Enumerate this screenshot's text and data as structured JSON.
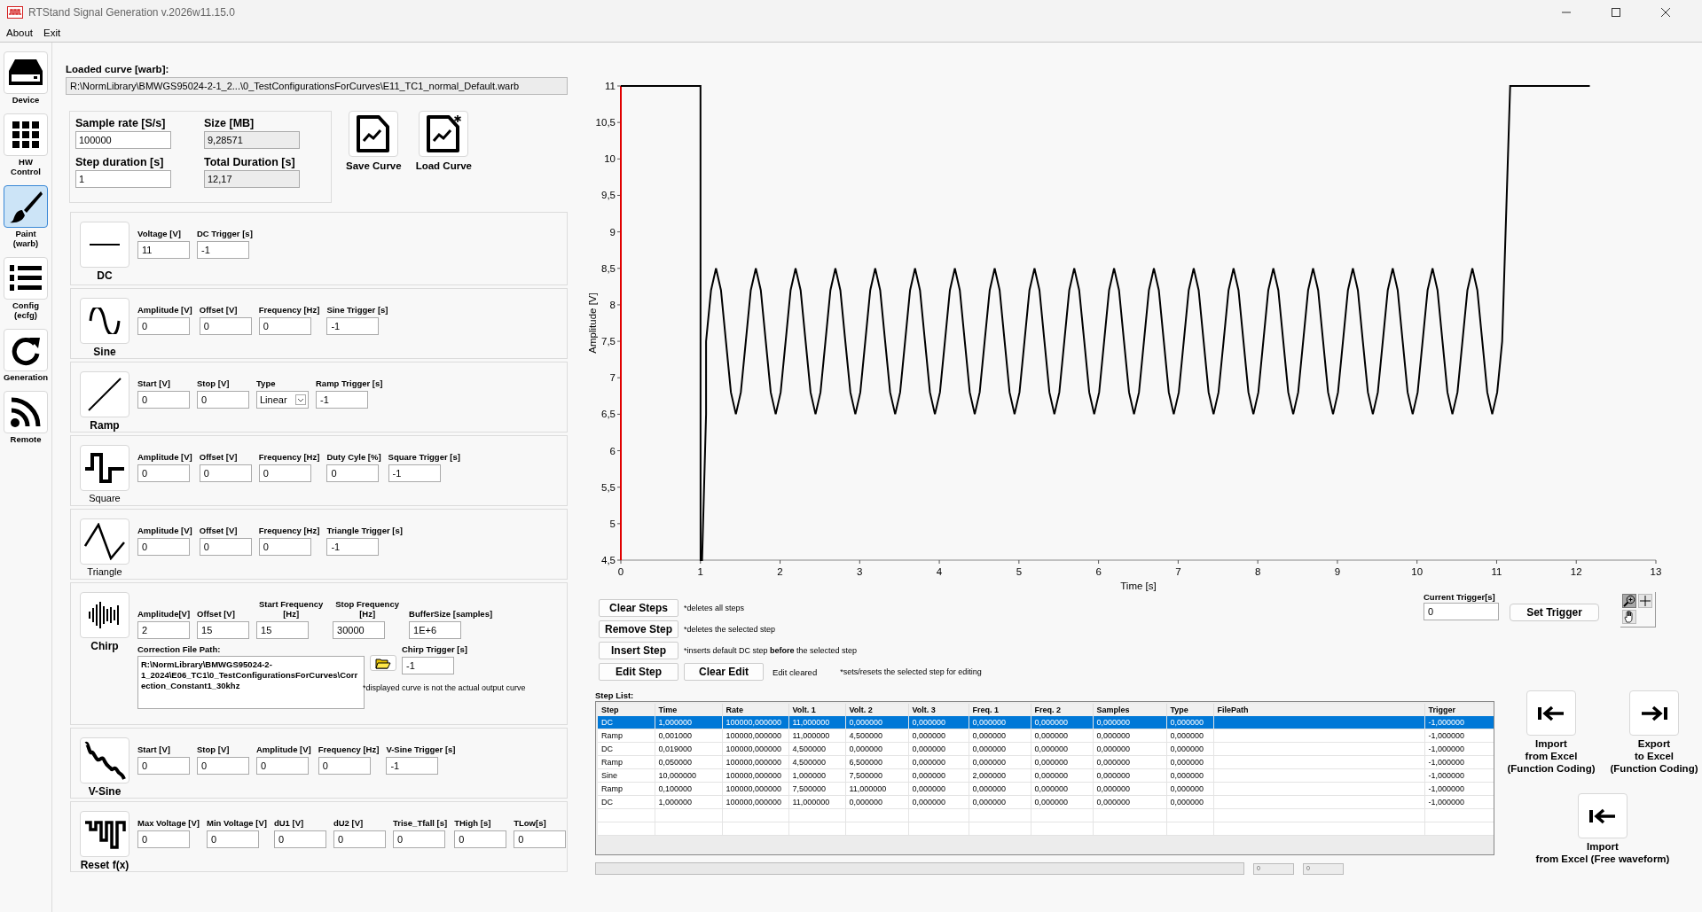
{
  "window": {
    "title": "RTStand Signal Generation v.2026w11.15.0"
  },
  "menu": [
    "About",
    "Exit"
  ],
  "sidebar": {
    "items": [
      {
        "label": "Device",
        "kind": "device",
        "selected": false
      },
      {
        "label": "HW Control",
        "kind": "grid",
        "selected": false
      },
      {
        "label": "Paint (warb)",
        "kind": "brush",
        "selected": true
      },
      {
        "label": "Config (ecfg)",
        "kind": "list",
        "selected": false
      },
      {
        "label": "Generation",
        "kind": "refresh",
        "selected": false
      },
      {
        "label": "Remote",
        "kind": "feed",
        "selected": false
      }
    ]
  },
  "loaded_curve": {
    "label": "Loaded curve [warb]:",
    "value": "R:\\NormLibrary\\BMWGS95024-2-1_2...\\0_TestConfigurationsForCurves\\E11_TC1_normal_Default.warb"
  },
  "parameters": [
    {
      "label": "Sample rate [S/s]",
      "value": "100000",
      "readonly": false
    },
    {
      "label": "Size [MB]",
      "value": "9,28571",
      "readonly": true
    },
    {
      "label": "Step duration [s]",
      "value": "1",
      "readonly": false
    },
    {
      "label": "Total Duration [s]",
      "value": "12,17",
      "readonly": true
    }
  ],
  "curve_buttons": [
    {
      "label": "Save Curve",
      "kind": "save"
    },
    {
      "label": "Load Curve",
      "kind": "load"
    }
  ],
  "functions": [
    {
      "name": "DC",
      "kind": "dc",
      "bold": true,
      "fields": [
        {
          "label": "Voltage [V]",
          "value": "11"
        },
        {
          "label": "DC Trigger [s]",
          "value": "-1"
        }
      ]
    },
    {
      "name": "Sine",
      "kind": "sine",
      "bold": true,
      "fields": [
        {
          "label": "Amplitude [V]",
          "value": "0"
        },
        {
          "label": "Offset [V]",
          "value": "0"
        },
        {
          "label": "Frequency [Hz]",
          "value": "0"
        },
        {
          "label": "Sine Trigger [s]",
          "value": "-1"
        }
      ]
    },
    {
      "name": "Ramp",
      "kind": "ramp",
      "bold": true,
      "fields": [
        {
          "label": "Start [V]",
          "value": "0"
        },
        {
          "label": "Stop [V]",
          "value": "0"
        },
        {
          "label": "Type",
          "value": "Linear",
          "kind": "select"
        },
        {
          "label": "Ramp Trigger [s]",
          "value": "-1"
        }
      ]
    },
    {
      "name": "Square",
      "kind": "square",
      "bold": false,
      "fields": [
        {
          "label": "Amplitude [V]",
          "value": "0"
        },
        {
          "label": "Offset [V]",
          "value": "0"
        },
        {
          "label": "Frequency [Hz]",
          "value": "0"
        },
        {
          "label": "Duty Cyle [%]",
          "value": "0"
        },
        {
          "label": "Square Trigger [s]",
          "value": "-1"
        }
      ]
    },
    {
      "name": "Triangle",
      "kind": "triangle",
      "bold": false,
      "fields": [
        {
          "label": "Amplitude [V]",
          "value": "0"
        },
        {
          "label": "Offset [V]",
          "value": "0"
        },
        {
          "label": "Frequency [Hz]",
          "value": "0"
        },
        {
          "label": "Triangle Trigger [s]",
          "value": "-1"
        }
      ]
    },
    {
      "name": "Chirp",
      "kind": "chirp",
      "bold": true,
      "fields": [
        {
          "label": "Amplitude[V]",
          "value": "2"
        },
        {
          "label": "Offset [V]",
          "value": "15"
        },
        {
          "label": "Start Frequency [Hz]",
          "value": "15"
        },
        {
          "label": "Stop Frequency [Hz]",
          "value": "30000"
        },
        {
          "label": "BufferSize [samples]",
          "value": "1E+6"
        }
      ],
      "file": {
        "label": "Correction File Path:",
        "value": "R:\\NormLibrary\\BMWGS95024-2-1_2024\\E06_TC1\\0_TestConfigurationsForCurves\\Correction_Constant1_30khz"
      },
      "trigger": {
        "label": "Chirp Trigger [s]",
        "value": "-1"
      },
      "note": "*displayed curve is not the actual output curve"
    },
    {
      "name": "V-Sine",
      "kind": "vsine",
      "bold": true,
      "fields": [
        {
          "label": "Start [V]",
          "value": "0"
        },
        {
          "label": "Stop [V]",
          "value": "0"
        },
        {
          "label": "Amplitude [V]",
          "value": "0"
        },
        {
          "label": "Frequency [Hz]",
          "value": "0"
        },
        {
          "label": "V-Sine Trigger [s]",
          "value": "-1"
        }
      ]
    },
    {
      "name": "Reset f(x)",
      "kind": "reset",
      "bold": true,
      "fields": [
        {
          "label": "Max Voltage [V]",
          "value": "0"
        },
        {
          "label": "Min Voltage [V]",
          "value": "0"
        },
        {
          "label": "dU1 [V]",
          "value": "0"
        },
        {
          "label": "dU2 [V]",
          "value": "0"
        },
        {
          "label": "Trise_Tfall [s]",
          "value": "0"
        },
        {
          "label": "THigh [s]",
          "value": "0"
        },
        {
          "label": "TLow[s]",
          "value": "0"
        }
      ]
    }
  ],
  "chart": {
    "chart_data": {
      "type": "line",
      "xlabel": "Time [s]",
      "ylabel": "Amplitude [V]",
      "xlim": [
        0,
        13
      ],
      "ylim": [
        4.5,
        11
      ],
      "xticks": [
        0,
        1,
        2,
        3,
        4,
        5,
        6,
        7,
        8,
        9,
        10,
        11,
        12,
        13
      ],
      "yticks": [
        {
          "value": 4.5,
          "label": "4,5"
        },
        5,
        {
          "value": 5.5,
          "label": "5,5"
        },
        6,
        {
          "value": 6.5,
          "label": "6,5"
        },
        7,
        {
          "value": 7.5,
          "label": "7,5"
        },
        8,
        {
          "value": 8.5,
          "label": "8,5"
        },
        9,
        {
          "value": 9.5,
          "label": "9,5"
        },
        10,
        {
          "value": 10.5,
          "label": "10,5"
        },
        11
      ],
      "x": [
        0,
        1,
        1.001,
        1.02,
        1.07,
        1.07,
        1.1325,
        1.195,
        1.2575,
        1.32,
        1.3825,
        1.445,
        1.5075,
        1.57,
        1.6325,
        1.695,
        1.7575,
        1.82,
        1.8825,
        1.945,
        2.0075,
        2.07,
        2.1325,
        2.195,
        2.2575,
        2.32,
        2.3825,
        2.445,
        2.5075,
        2.57,
        2.6325,
        2.695,
        2.7575,
        2.82,
        2.8825,
        2.945,
        3.0075,
        3.07,
        3.1325,
        3.195,
        3.2575,
        3.32,
        3.3825,
        3.445,
        3.5075,
        3.57,
        3.6325,
        3.695,
        3.7575,
        3.82,
        3.8825,
        3.945,
        4.0075,
        4.07,
        4.1325,
        4.195,
        4.2575,
        4.32,
        4.3825,
        4.445,
        4.5075,
        4.57,
        4.6325,
        4.695,
        4.7575,
        4.82,
        4.8825,
        4.945,
        5.0075,
        5.07,
        5.1325,
        5.195,
        5.2575,
        5.32,
        5.3825,
        5.445,
        5.5075,
        5.57,
        5.6325,
        5.695,
        5.7575,
        5.82,
        5.8825,
        5.945,
        6.0075,
        6.07,
        6.1325,
        6.195,
        6.2575,
        6.32,
        6.3825,
        6.445,
        6.5075,
        6.57,
        6.6325,
        6.695,
        6.7575,
        6.82,
        6.8825,
        6.945,
        7.0075,
        7.07,
        7.1325,
        7.195,
        7.2575,
        7.32,
        7.3825,
        7.445,
        7.5075,
        7.57,
        7.6325,
        7.695,
        7.7575,
        7.82,
        7.8825,
        7.945,
        8.0075,
        8.07,
        8.1325,
        8.195,
        8.2575,
        8.32,
        8.3825,
        8.445,
        8.5075,
        8.57,
        8.6325,
        8.695,
        8.7575,
        8.82,
        8.8825,
        8.945,
        9.0075,
        9.07,
        9.1325,
        9.195,
        9.2575,
        9.32,
        9.3825,
        9.445,
        9.5075,
        9.57,
        9.6325,
        9.695,
        9.7575,
        9.82,
        9.8825,
        9.945,
        10.0075,
        10.07,
        10.1325,
        10.195,
        10.2575,
        10.32,
        10.3825,
        10.445,
        10.5075,
        10.57,
        10.6325,
        10.695,
        10.7575,
        10.82,
        10.8825,
        10.945,
        11.0075,
        11.07,
        11.17,
        12.17
      ],
      "series": [
        {
          "color": "#000000",
          "values": [
            11,
            11,
            4.5,
            4.5,
            6.5,
            7.5,
            8.2,
            8.5,
            8.2,
            7.5,
            6.8,
            6.5,
            6.8,
            7.5,
            8.2,
            8.5,
            8.2,
            7.5,
            6.8,
            6.5,
            6.8,
            7.5,
            8.2,
            8.5,
            8.2,
            7.5,
            6.8,
            6.5,
            6.8,
            7.5,
            8.2,
            8.5,
            8.2,
            7.5,
            6.8,
            6.5,
            6.8,
            7.5,
            8.2,
            8.5,
            8.2,
            7.5,
            6.8,
            6.5,
            6.8,
            7.5,
            8.2,
            8.5,
            8.2,
            7.5,
            6.8,
            6.5,
            6.8,
            7.5,
            8.2,
            8.5,
            8.2,
            7.5,
            6.8,
            6.5,
            6.8,
            7.5,
            8.2,
            8.5,
            8.2,
            7.5,
            6.8,
            6.5,
            6.8,
            7.5,
            8.2,
            8.5,
            8.2,
            7.5,
            6.8,
            6.5,
            6.8,
            7.5,
            8.2,
            8.5,
            8.2,
            7.5,
            6.8,
            6.5,
            6.8,
            7.5,
            8.2,
            8.5,
            8.2,
            7.5,
            6.8,
            6.5,
            6.8,
            7.5,
            8.2,
            8.5,
            8.2,
            7.5,
            6.8,
            6.5,
            6.8,
            7.5,
            8.2,
            8.5,
            8.2,
            7.5,
            6.8,
            6.5,
            6.8,
            7.5,
            8.2,
            8.5,
            8.2,
            7.5,
            6.8,
            6.5,
            6.8,
            7.5,
            8.2,
            8.5,
            8.2,
            7.5,
            6.8,
            6.5,
            6.8,
            7.5,
            8.2,
            8.5,
            8.2,
            7.5,
            6.8,
            6.5,
            6.8,
            7.5,
            8.2,
            8.5,
            8.2,
            7.5,
            6.8,
            6.5,
            6.8,
            7.5,
            8.2,
            8.5,
            8.2,
            7.5,
            6.8,
            6.5,
            6.8,
            7.5,
            8.2,
            8.5,
            8.2,
            7.5,
            6.8,
            6.5,
            6.8,
            7.5,
            8.2,
            8.5,
            8.2,
            7.5,
            6.8,
            6.5,
            6.8,
            7.5,
            11,
            11
          ]
        }
      ]
    }
  },
  "step_actions": [
    {
      "buttons": [
        "Clear Steps"
      ],
      "note": "*deletes all steps"
    },
    {
      "buttons": [
        "Remove Step"
      ],
      "note": "*deletes the selected step"
    },
    {
      "buttons": [
        "Insert Step"
      ],
      "note": "*inserts default DC step **before** the selected step"
    },
    {
      "buttons": [
        "Edit Step",
        "Clear Edit"
      ],
      "status": "Edit cleared",
      "note": "*sets/resets the selected step for editing"
    }
  ],
  "trigger": {
    "label": "Current Trigger[s]",
    "value": "0",
    "button": "Set Trigger"
  },
  "graph_tools": [
    {
      "kind": "zoom",
      "selected": true
    },
    {
      "kind": "crosshair",
      "selected": false
    },
    {
      "kind": "pan",
      "selected": false
    }
  ],
  "step_list": {
    "label": "Step List:",
    "columns": [
      "Step",
      "Time",
      "Rate",
      "Volt. 1",
      "Volt. 2",
      "Volt. 3",
      "Freq. 1",
      "Freq. 2",
      "Samples",
      "Type",
      "FilePath",
      "Trigger"
    ],
    "rows": [
      {
        "selected": true,
        "step": "DC",
        "time": "1,000000",
        "rate": "100000,000000",
        "volt_1": "11,000000",
        "volt_2": "0,000000",
        "volt_3": "0,000000",
        "freq_1": "0,000000",
        "freq_2": "0,000000",
        "samples": "0,000000",
        "type": "0,000000",
        "trigger": "-1,000000"
      },
      {
        "selected": false,
        "step": "Ramp",
        "time": "0,001000",
        "rate": "100000,000000",
        "volt_1": "11,000000",
        "volt_2": "4,500000",
        "volt_3": "0,000000",
        "freq_1": "0,000000",
        "freq_2": "0,000000",
        "samples": "0,000000",
        "type": "0,000000",
        "trigger": "-1,000000"
      },
      {
        "selected": false,
        "step": "DC",
        "time": "0,019000",
        "rate": "100000,000000",
        "volt_1": "4,500000",
        "volt_2": "0,000000",
        "volt_3": "0,000000",
        "freq_1": "0,000000",
        "freq_2": "0,000000",
        "samples": "0,000000",
        "type": "0,000000",
        "trigger": "-1,000000"
      },
      {
        "selected": false,
        "step": "Ramp",
        "time": "0,050000",
        "rate": "100000,000000",
        "volt_1": "4,500000",
        "volt_2": "6,500000",
        "volt_3": "0,000000",
        "freq_1": "0,000000",
        "freq_2": "0,000000",
        "samples": "0,000000",
        "type": "0,000000",
        "trigger": "-1,000000"
      },
      {
        "selected": false,
        "step": "Sine",
        "time": "10,000000",
        "rate": "100000,000000",
        "volt_1": "1,000000",
        "volt_2": "7,500000",
        "volt_3": "0,000000",
        "freq_1": "2,000000",
        "freq_2": "0,000000",
        "samples": "0,000000",
        "type": "0,000000",
        "trigger": "-1,000000"
      },
      {
        "selected": false,
        "step": "Ramp",
        "time": "0,100000",
        "rate": "100000,000000",
        "volt_1": "7,500000",
        "volt_2": "11,000000",
        "volt_3": "0,000000",
        "freq_1": "0,000000",
        "freq_2": "0,000000",
        "samples": "0,000000",
        "type": "0,000000",
        "trigger": "-1,000000"
      },
      {
        "selected": false,
        "step": "DC",
        "time": "1,000000",
        "rate": "100000,000000",
        "volt_1": "11,000000",
        "volt_2": "0,000000",
        "volt_3": "0,000000",
        "freq_1": "0,000000",
        "freq_2": "0,000000",
        "samples": "0,000000",
        "type": "0,000000",
        "trigger": "-1,000000"
      }
    ]
  },
  "progress": {
    "level": 0,
    "readouts": [
      "0",
      "0"
    ]
  },
  "excel_buttons": [
    {
      "label": "Import\nfrom Excel\n(Function Coding)",
      "kind": "import"
    },
    {
      "label": "Export\nto Excel\n(Function Coding)",
      "kind": "export"
    },
    {
      "label": "Import\nfrom Excel (Free waveform)",
      "kind": "import"
    }
  ]
}
